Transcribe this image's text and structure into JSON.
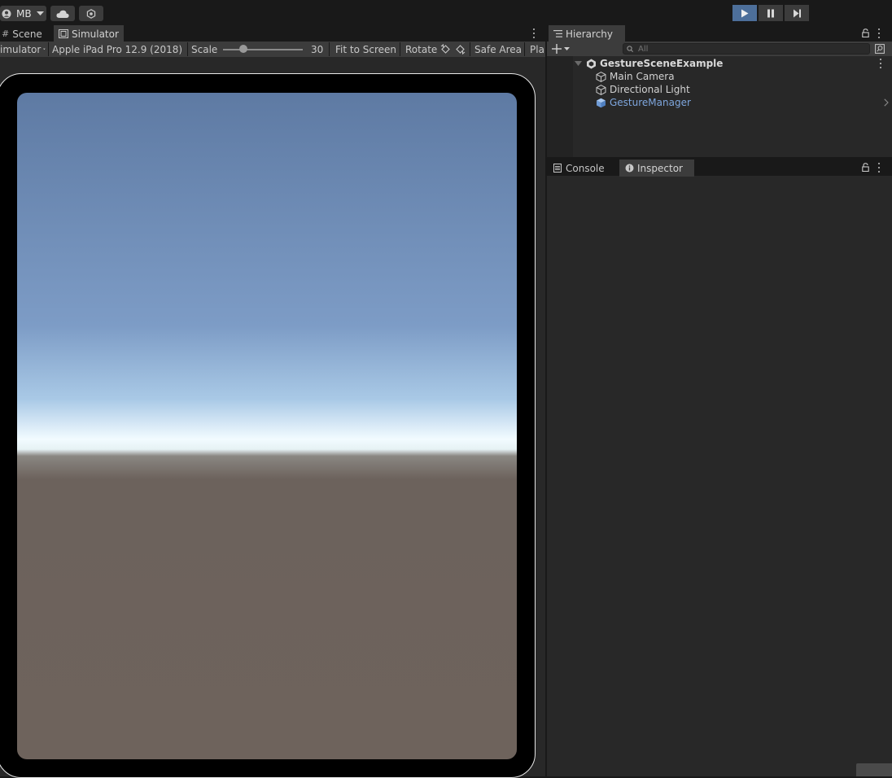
{
  "toolbar": {
    "account_label": "MB",
    "cloud_icon": "cloud-icon",
    "collab_icon": "collab-icon"
  },
  "play_controls": {
    "play_icon": "play-icon",
    "pause_icon": "pause-icon",
    "step_icon": "step-icon"
  },
  "game_panel": {
    "tabs": [
      {
        "label": "Scene",
        "icon": "grid-icon",
        "active": false
      },
      {
        "label": "Simulator",
        "icon": "simulator-icon",
        "active": true
      }
    ],
    "mode_dropdown": "imulator",
    "device_dropdown": "Apple iPad Pro 12.9 (2018)",
    "scale_label": "Scale",
    "scale_value": "30",
    "scale_fraction": 0.25,
    "fit_label": "Fit to Screen",
    "rotate_label": "Rotate",
    "safe_area_label": "Safe Area",
    "play_label": "Pla"
  },
  "hierarchy": {
    "tab_label": "Hierarchy",
    "search_placeholder": "All",
    "scene_name": "GestureSceneExample",
    "items": [
      {
        "label": "Main Camera",
        "selected": false
      },
      {
        "label": "Directional Light",
        "selected": false
      },
      {
        "label": "GestureManager",
        "selected": true
      }
    ]
  },
  "lower_panel": {
    "tabs": [
      {
        "label": "Console",
        "icon": "console-icon",
        "active": false
      },
      {
        "label": "Inspector",
        "icon": "info-icon",
        "active": true
      }
    ]
  },
  "colors": {
    "accent": "#4d6f9a",
    "selected_text": "#7ea6dd",
    "sky_top": "#5e7aa3",
    "horizon": "#f2fbff",
    "ground": "#6c625c"
  }
}
